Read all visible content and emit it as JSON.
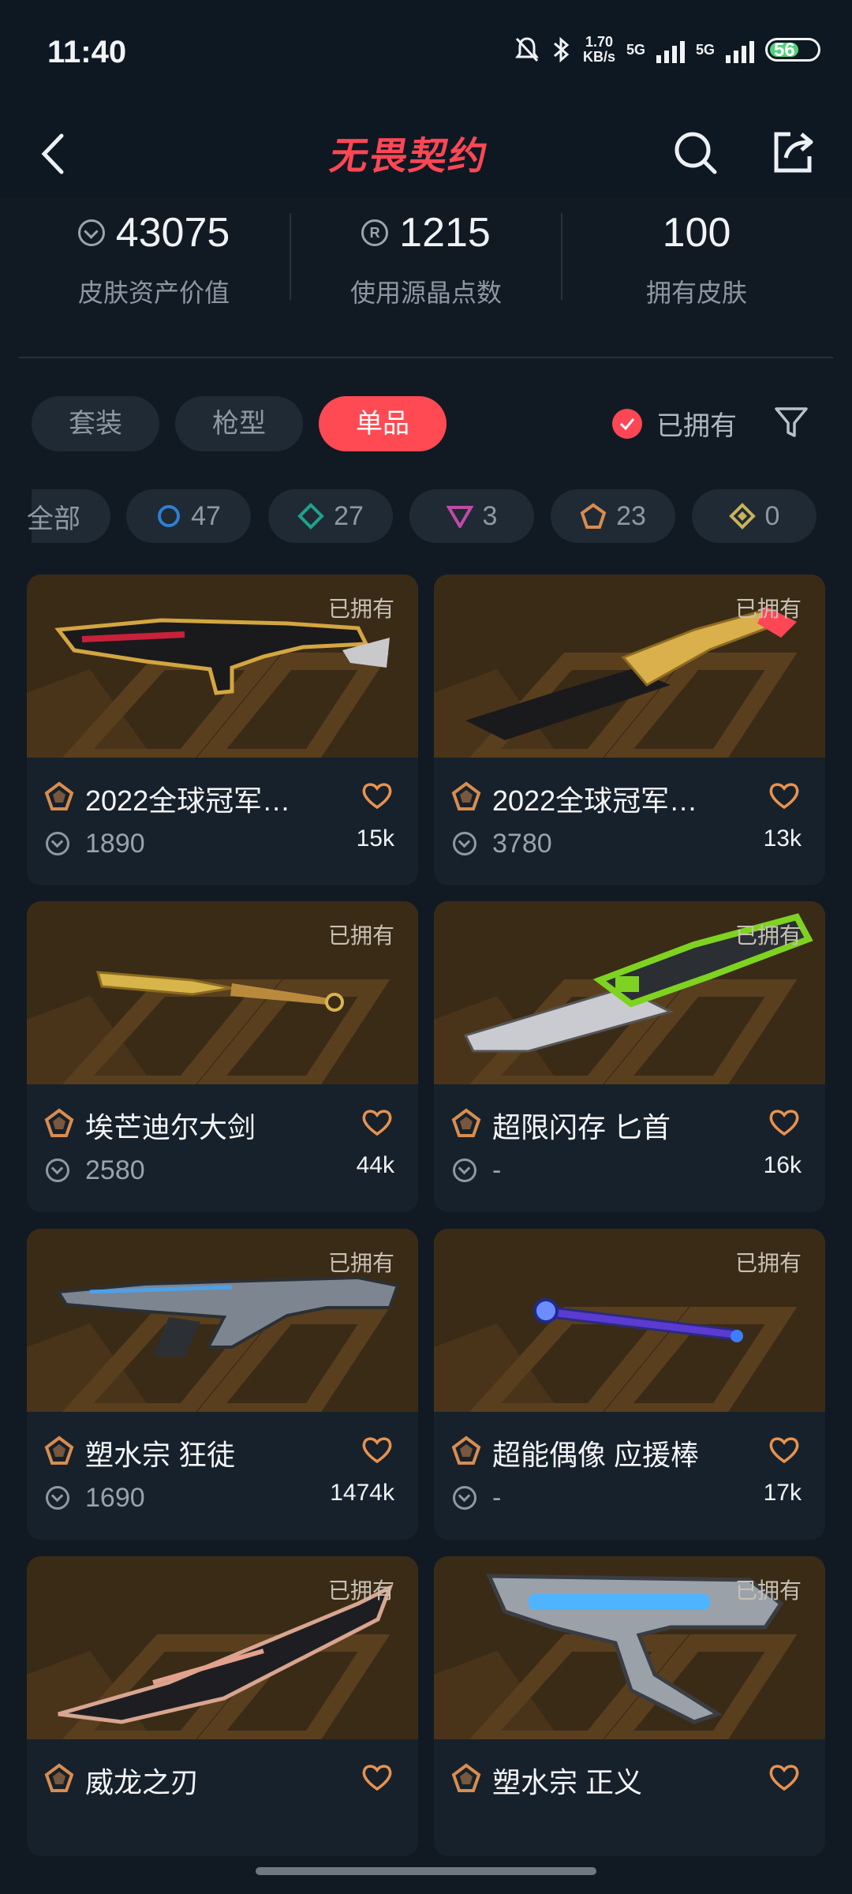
{
  "status_bar": {
    "time": "11:40",
    "net_speed": "1.70",
    "net_unit": "KB/s",
    "sim1": "5G",
    "sim2": "5G",
    "battery": "56"
  },
  "header": {
    "logo_text": "无畏契约"
  },
  "stats": [
    {
      "value": "43075",
      "label": "皮肤资产价值",
      "icon": "vp-icon"
    },
    {
      "value": "1215",
      "label": "使用源晶点数",
      "icon": "radianite-icon"
    },
    {
      "value": "100",
      "label": "拥有皮肤"
    }
  ],
  "tabs": [
    {
      "label": "套装",
      "active": false
    },
    {
      "label": "枪型",
      "active": false
    },
    {
      "label": "单品",
      "active": true
    }
  ],
  "owned_toggle": {
    "label": "已拥有",
    "checked": true
  },
  "tiers": [
    {
      "label": "全部"
    },
    {
      "count": "47",
      "color": "#2e7fd1",
      "icon": "select-tier-icon"
    },
    {
      "count": "27",
      "color": "#1ba38d",
      "icon": "deluxe-tier-icon"
    },
    {
      "count": "3",
      "color": "#c04aa7",
      "icon": "ultra-tier-icon"
    },
    {
      "count": "23",
      "color": "#d88d4f",
      "icon": "exclusive-tier-icon"
    },
    {
      "count": "0",
      "color": "#c9b25a",
      "icon": "premium-tier-icon"
    }
  ],
  "items": [
    {
      "name": "2022全球冠军…",
      "price": "1890",
      "likes": "15k",
      "owned": "已拥有"
    },
    {
      "name": "2022全球冠军…",
      "price": "3780",
      "likes": "13k",
      "owned": "已拥有"
    },
    {
      "name": "埃芒迪尔大剑",
      "price": "2580",
      "likes": "44k",
      "owned": "已拥有"
    },
    {
      "name": "超限闪存 匕首",
      "price": "-",
      "likes": "16k",
      "owned": "已拥有"
    },
    {
      "name": "塑水宗 狂徒",
      "price": "1690",
      "likes": "1474k",
      "owned": "已拥有"
    },
    {
      "name": "超能偶像 应援棒",
      "price": "-",
      "likes": "17k",
      "owned": "已拥有"
    },
    {
      "name": "威龙之刃",
      "owned": "已拥有"
    },
    {
      "name": "塑水宗 正义",
      "owned": "已拥有"
    }
  ],
  "colors": {
    "accent": "#ff4655",
    "exclusive": "#d88d4f",
    "heart": "#e8924f"
  }
}
